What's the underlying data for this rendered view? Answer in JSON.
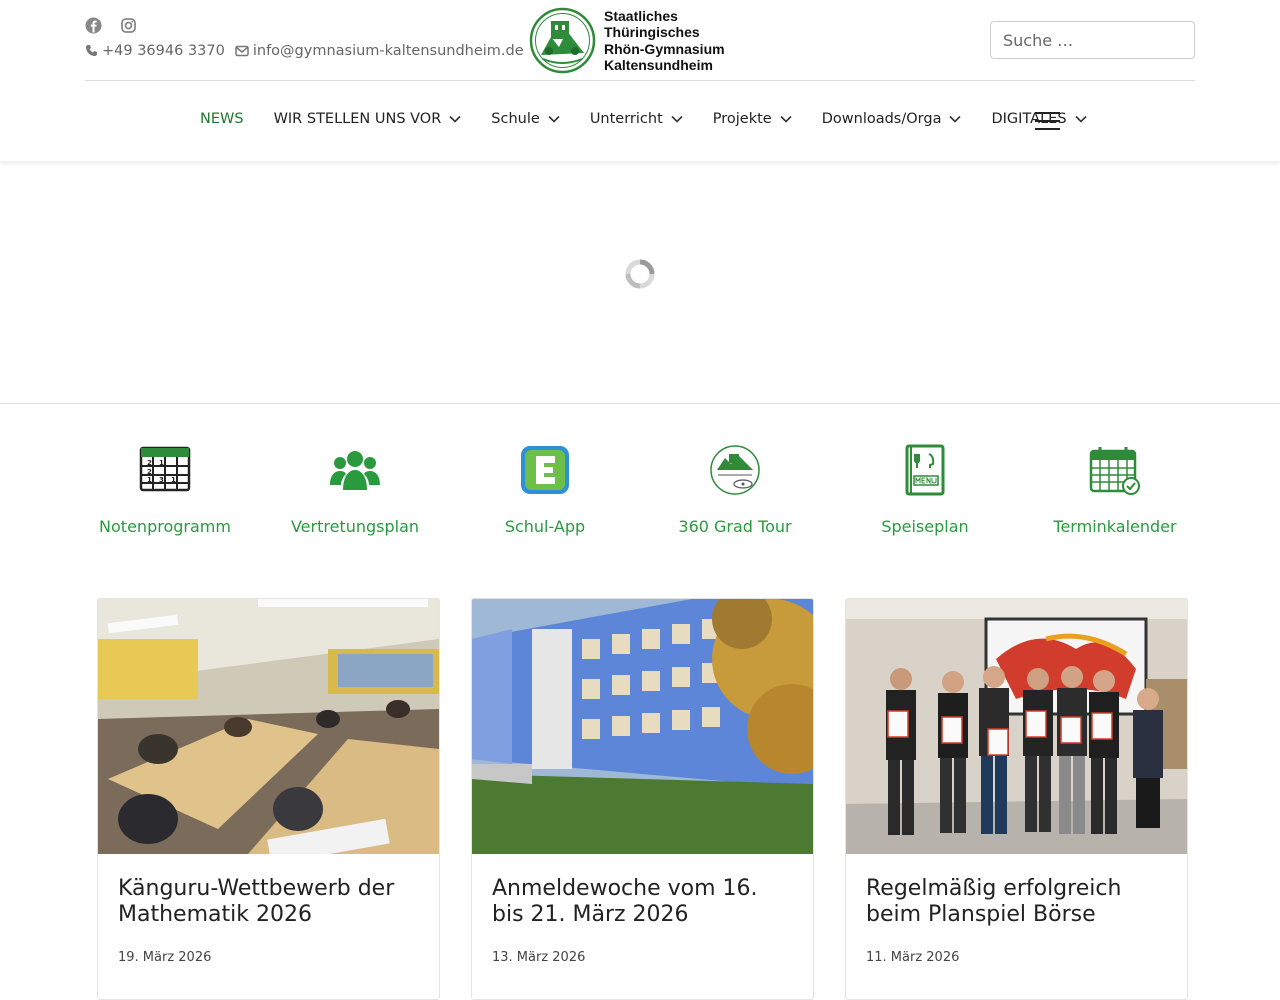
{
  "header": {
    "phone": "+49 36946 3370",
    "email": "info@gymnasium-kaltensundheim.de",
    "logo_lines": [
      "Staatliches",
      "Thüringisches",
      "Rhön-Gymnasium",
      "Kaltensundheim"
    ],
    "search_placeholder": "Suche …"
  },
  "nav": {
    "items": [
      {
        "label": "NEWS",
        "dropdown": false,
        "active": true
      },
      {
        "label": "WIR STELLEN UNS VOR",
        "dropdown": true
      },
      {
        "label": "Schule",
        "dropdown": true
      },
      {
        "label": "Unterricht",
        "dropdown": true
      },
      {
        "label": "Projekte",
        "dropdown": true
      },
      {
        "label": "Downloads/Orga",
        "dropdown": true
      },
      {
        "label": "DIGITALES",
        "dropdown": true
      }
    ]
  },
  "quicklinks": [
    {
      "label": "Notenprogramm",
      "icon": "grade-table-icon"
    },
    {
      "label": "Vertretungsplan",
      "icon": "users-group-icon"
    },
    {
      "label": "Schul-App",
      "icon": "e-app-icon"
    },
    {
      "label": "360 Grad Tour",
      "icon": "tour-360-icon"
    },
    {
      "label": "Speiseplan",
      "icon": "menu-book-icon"
    },
    {
      "label": "Terminkalender",
      "icon": "calendar-check-icon"
    }
  ],
  "posts": [
    {
      "title": "Känguru-Wettbewerb der Mathematik 2026",
      "date": "19. März 2026"
    },
    {
      "title": "Anmeldewoche vom 16. bis 21. März 2026",
      "date": "13. März 2026"
    },
    {
      "title": "Regelmäßig erfolgreich beim Planspiel Börse",
      "date": "11. März 2026"
    }
  ],
  "colors": {
    "accent_green": "#2a9a3e",
    "nav_active": "#1e7a2e",
    "text": "#222222"
  }
}
